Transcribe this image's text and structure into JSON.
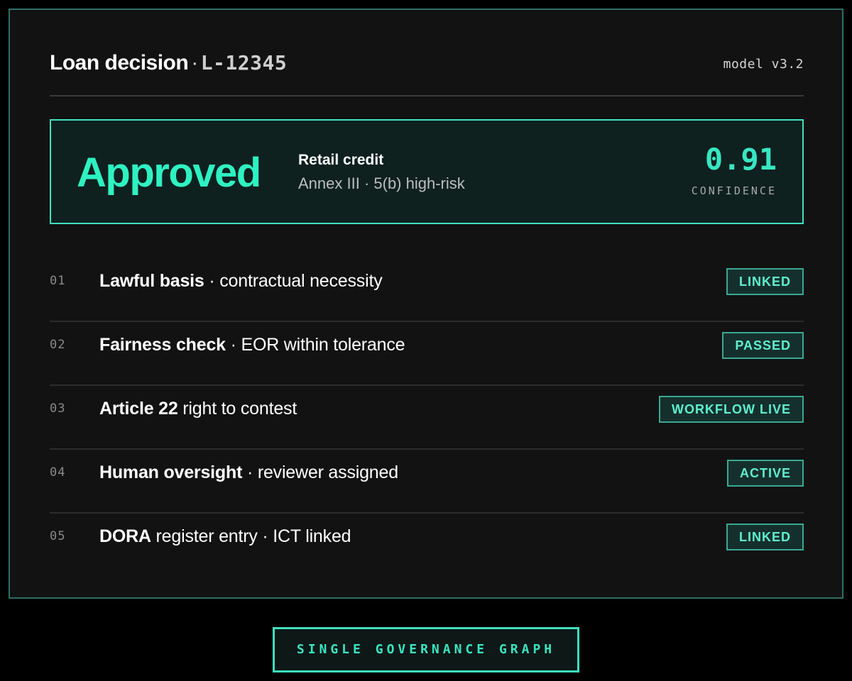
{
  "header": {
    "title": "Loan decision",
    "separator": "·",
    "loan_id": "L-12345",
    "model": "model v3.2"
  },
  "decision": {
    "status": "Approved",
    "classification": "Retail credit",
    "annex": "Annex III · 5(b) high-risk",
    "confidence_value": "0.91",
    "confidence_label": "CONFIDENCE"
  },
  "checks": [
    {
      "num": "01",
      "strong": "Lawful basis",
      "rest": " · contractual necessity",
      "badge": "LINKED"
    },
    {
      "num": "02",
      "strong": "Fairness check",
      "rest": " · EOR within tolerance",
      "badge": "PASSED"
    },
    {
      "num": "03",
      "strong": "Article 22",
      "rest": " right to contest",
      "badge": "WORKFLOW LIVE"
    },
    {
      "num": "04",
      "strong": "Human oversight",
      "rest": " · reviewer assigned",
      "badge": "ACTIVE"
    },
    {
      "num": "05",
      "strong": "DORA",
      "rest": " register entry · ICT linked",
      "badge": "LINKED"
    }
  ],
  "footer": {
    "tag": "SINGLE GOVERNANCE GRAPH"
  },
  "colors": {
    "accent": "#2ef2c2",
    "panel_bg": "#121212",
    "badge_bg": "#15302c",
    "badge_border": "#3aa894"
  }
}
